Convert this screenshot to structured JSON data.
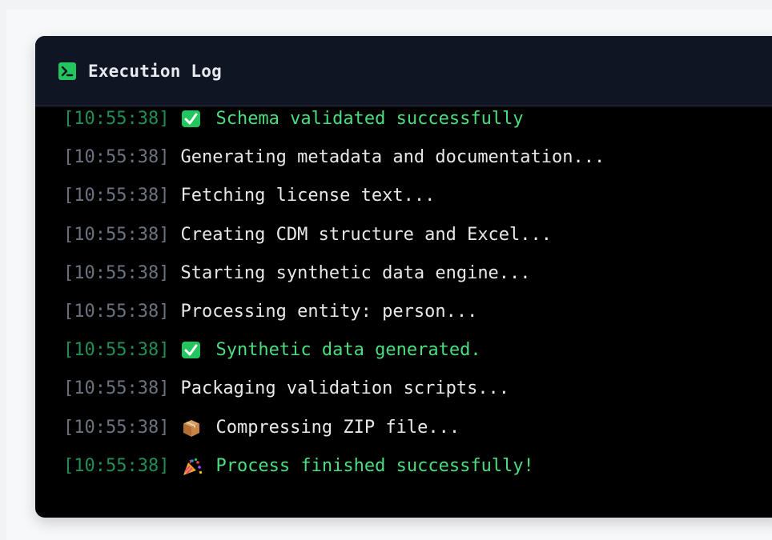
{
  "log": {
    "title": "Execution Log",
    "header_icon": "terminal-icon",
    "entries": [
      {
        "timestamp": "[10:55:38]",
        "icon": "check-icon",
        "message": "Schema validated successfully",
        "status": "success"
      },
      {
        "timestamp": "[10:55:38]",
        "icon": "",
        "message": "Generating metadata and documentation...",
        "status": "info"
      },
      {
        "timestamp": "[10:55:38]",
        "icon": "",
        "message": "Fetching license text...",
        "status": "info"
      },
      {
        "timestamp": "[10:55:38]",
        "icon": "",
        "message": "Creating CDM structure and Excel...",
        "status": "info"
      },
      {
        "timestamp": "[10:55:38]",
        "icon": "",
        "message": "Starting synthetic data engine...",
        "status": "info"
      },
      {
        "timestamp": "[10:55:38]",
        "icon": "",
        "message": "Processing entity: person...",
        "status": "info"
      },
      {
        "timestamp": "[10:55:38]",
        "icon": "check-icon",
        "message": "Synthetic data generated.",
        "status": "success"
      },
      {
        "timestamp": "[10:55:38]",
        "icon": "",
        "message": "Packaging validation scripts...",
        "status": "info"
      },
      {
        "timestamp": "[10:55:38]",
        "icon": "package-icon",
        "message": "Compressing ZIP file...",
        "status": "info"
      },
      {
        "timestamp": "[10:55:38]",
        "icon": "party-popper-icon",
        "message": "Process finished successfully!",
        "status": "success"
      }
    ]
  },
  "colors": {
    "background": "#000000",
    "header": "#0f1522",
    "success_text": "#4ade80",
    "timestamp": "#6b7280",
    "accent": "#22c55e"
  }
}
